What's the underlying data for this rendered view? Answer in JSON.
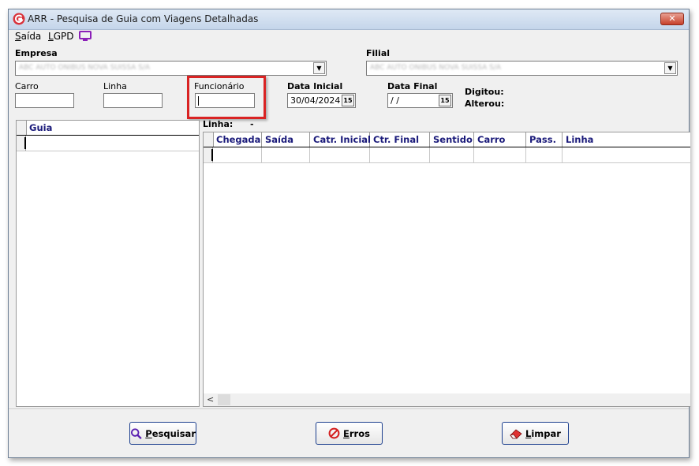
{
  "window": {
    "title": "ARR - Pesquisa de Guia com Viagens Detalhadas",
    "close_icon": "close-icon"
  },
  "menu": {
    "items": [
      {
        "accel": "S",
        "rest": "aída"
      },
      {
        "accel": "L",
        "rest": "GPD"
      }
    ],
    "tv_icon": "monitor-icon"
  },
  "empresa": {
    "label": "Empresa",
    "value": "ABC AUTO ONIBUS NOVA SUISSA S/A"
  },
  "filial": {
    "label": "Filial",
    "value": "ABC AUTO ONIBUS NOVA SUISSA S/A"
  },
  "carro": {
    "label": "Carro",
    "value": ""
  },
  "linha": {
    "label": "Linha",
    "value": ""
  },
  "funcionario": {
    "label": "Funcionário",
    "value": ""
  },
  "data_inicial": {
    "label": "Data Inicial",
    "value": "30/04/2024",
    "btn": "15"
  },
  "data_final": {
    "label": "Data Final",
    "value": " / /",
    "btn": "15"
  },
  "digitou": {
    "label": "Digitou:"
  },
  "alterou": {
    "label": "Alterou:"
  },
  "linha_info": {
    "label": "Linha:",
    "value": "-"
  },
  "guia_grid": {
    "columns": [
      "Guia"
    ]
  },
  "viagens_grid": {
    "columns": [
      "Chegada",
      "Saída",
      "Catr. Inicial",
      "Ctr. Final",
      "Sentido",
      "Carro",
      "Pass.",
      "Linha"
    ]
  },
  "buttons": {
    "pesquisar": {
      "accel": "P",
      "rest": "esquisar"
    },
    "erros": {
      "accel": "E",
      "rest": "rros"
    },
    "limpar": {
      "accel": "L",
      "rest": "impar"
    }
  },
  "colors": {
    "header_text": "#1a1a7a",
    "highlight": "#d92323",
    "button_border": "#1c3f8e"
  }
}
